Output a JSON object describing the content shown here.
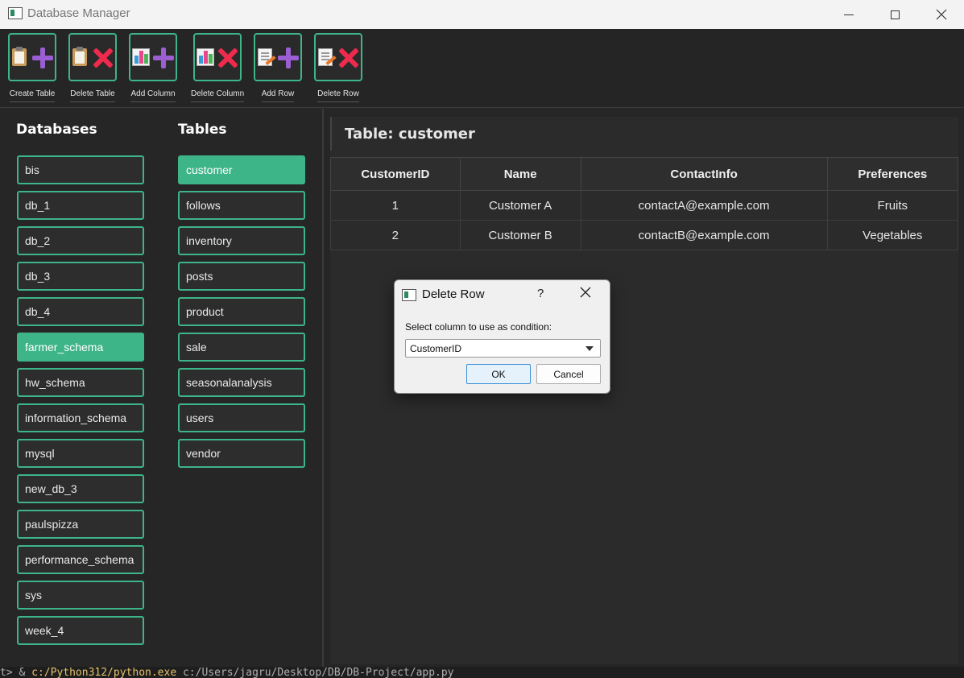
{
  "window": {
    "title": "Database Manager"
  },
  "toolbar": {
    "buttons": [
      {
        "label": "Create Table",
        "icon": "clipboard-add-icon"
      },
      {
        "label": "Delete Table",
        "icon": "clipboard-delete-icon"
      },
      {
        "label": "Add Column",
        "icon": "chart-add-icon"
      },
      {
        "label": "Delete Column",
        "icon": "chart-delete-icon"
      },
      {
        "label": "Add Row",
        "icon": "edit-add-icon"
      },
      {
        "label": "Delete Row",
        "icon": "edit-delete-icon"
      }
    ]
  },
  "databases": {
    "heading": "Databases",
    "items": [
      "bis",
      "db_1",
      "db_2",
      "db_3",
      "db_4",
      "farmer_schema",
      "hw_schema",
      "information_schema",
      "mysql",
      "new_db_3",
      "paulspizza",
      "performance_schema",
      "sys",
      "week_4"
    ],
    "selected": "farmer_schema"
  },
  "tables": {
    "heading": "Tables",
    "items": [
      "customer",
      "follows",
      "inventory",
      "posts",
      "product",
      "sale",
      "seasonalanalysis",
      "users",
      "vendor"
    ],
    "selected": "customer"
  },
  "main": {
    "title": "Table: customer",
    "columns": [
      "CustomerID",
      "Name",
      "ContactInfo",
      "Preferences"
    ],
    "rows": [
      [
        "1",
        "Customer A",
        "contactA@example.com",
        "Fruits"
      ],
      [
        "2",
        "Customer B",
        "contactB@example.com",
        "Vegetables"
      ]
    ]
  },
  "dialog": {
    "title": "Delete Row",
    "help": "?",
    "prompt": "Select column to use as condition:",
    "selected_column": "CustomerID",
    "ok_label": "OK",
    "cancel_label": "Cancel"
  },
  "terminal": {
    "prefix": "t> & ",
    "exe": "c:/Python312/python.exe",
    "path": " c:/Users/jagru/Desktop/DB/DB-Project/app.py"
  },
  "colors": {
    "accent": "#3eb489",
    "background": "#262626",
    "plus": "#9b5fd3",
    "delete": "#ee2a4d"
  }
}
